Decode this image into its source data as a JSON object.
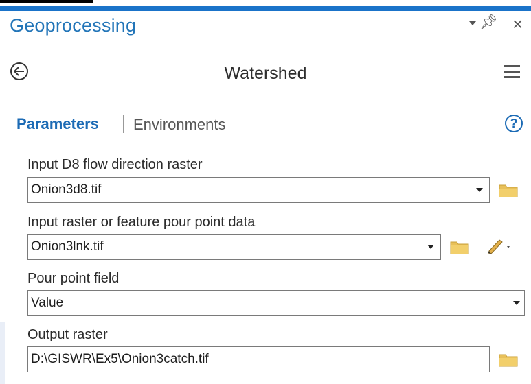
{
  "pane": {
    "title": "Geoprocessing",
    "controls": [
      "menu-dropdown-icon",
      "pin-icon",
      "close-icon"
    ],
    "accent_color": "#1a73c9"
  },
  "tool": {
    "title": "Watershed"
  },
  "tabs": {
    "parameters": "Parameters",
    "environments": "Environments",
    "active": "Parameters"
  },
  "params": {
    "d8": {
      "label": "Input D8 flow direction raster",
      "value": "Onion3d8.tif"
    },
    "pour_point": {
      "label": "Input raster or feature pour point data",
      "value": "Onion3lnk.tif"
    },
    "pour_field": {
      "label": "Pour point field",
      "value": "Value"
    },
    "output": {
      "label": "Output raster",
      "value": "D:\\GISWR\\Ex5\\Onion3catch.tif"
    }
  },
  "icons": {
    "back": "back-arrow-icon",
    "menu": "hamburger-menu-icon",
    "help": "help-icon",
    "browse": "folder-icon",
    "sketch": "pencil-icon"
  }
}
